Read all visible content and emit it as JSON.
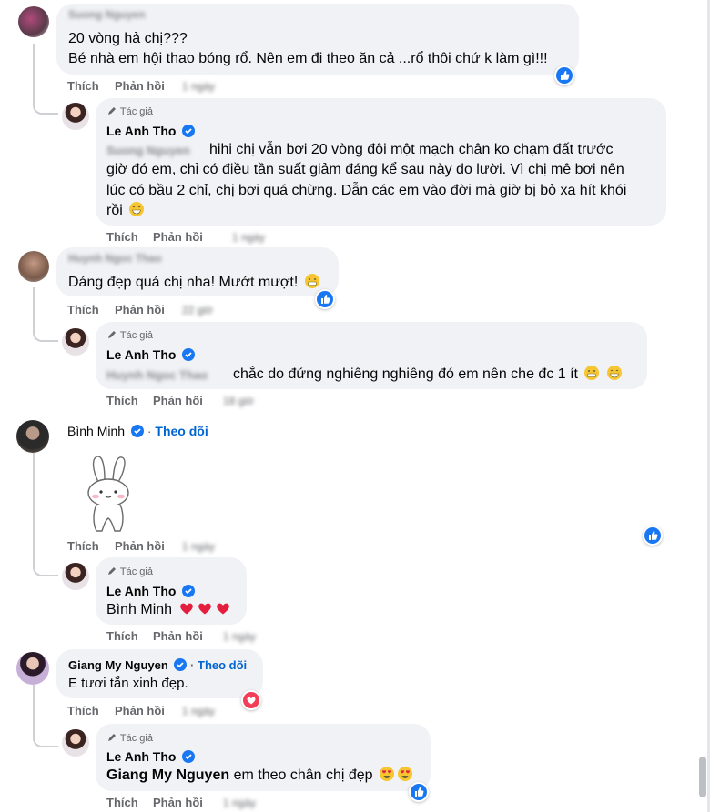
{
  "actions": {
    "like": "Thích",
    "reply": "Phản hồi",
    "follow": "Theo dõi"
  },
  "author_label": "Tác giả",
  "comments": [
    {
      "name": "Suong Nguyen",
      "lines": [
        "20 vòng hả chị???",
        "Bé nhà em hội thao bóng rổ. Nên em đi theo ăn cả ...rổ thôi chứ k làm gì!!!"
      ],
      "time": "1 ngày",
      "reply": {
        "name": "Le Anh Tho",
        "mention": "Suong Nguyen",
        "lines": [
          "hihi chị vẫn bơi 20 vòng đôi một mạch chân ko chạm đất trước",
          "giờ đó em, chỉ có điều tần suất giảm đáng kể sau này do lười. Vì chị mê bơi nên",
          "lúc có bầu 2 chỉ, chị bơi quá chừng. Dẫn các em vào đời mà giờ bị bỏ xa hít khói",
          "rồi"
        ],
        "time": "1 ngày"
      }
    },
    {
      "name": "Huynh Ngoc Thao",
      "text": "Dáng đẹp quá chị nha! Mướt mượt!",
      "time": "22 giờ",
      "reply": {
        "name": "Le Anh Tho",
        "mention": "Huynh Ngoc Thao",
        "text": "chắc do đứng nghiêng nghiêng đó em nên che đc 1 ít",
        "time": "18 giờ"
      }
    },
    {
      "name": "Bình Minh",
      "time": "1 ngày",
      "reply": {
        "name": "Le Anh Tho",
        "text": "Bình Minh",
        "time": "1 ngày"
      }
    },
    {
      "name": "Giang My Nguyen",
      "text": "E tươi tắn xinh đẹp.",
      "time": "1 ngày",
      "reply": {
        "name": "Le Anh Tho",
        "mention": "Giang My Nguyen",
        "text": "em theo chân chị đẹp",
        "time": "1 ngày"
      }
    }
  ],
  "colors": {
    "bubble": "#f0f2f5",
    "verified": "#1877f2",
    "like": "#1877f2",
    "love": "#f33e58",
    "heart": "#e41e3f"
  }
}
